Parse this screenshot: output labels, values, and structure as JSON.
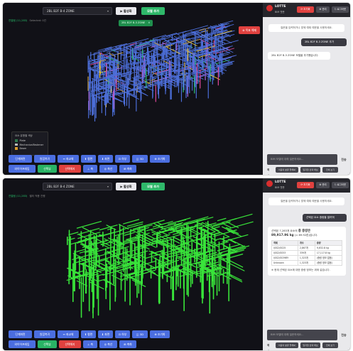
{
  "colors": {
    "green": "#29b365",
    "blue": "#4b6ee0",
    "red": "#e0413f",
    "beam": "#4c6ed8",
    "selected": "#39e43a"
  },
  "panel1": {
    "zone_select": "2BL B2F B-4 ZONE",
    "run_button": "▶ 활성화",
    "add_button": "모델 추가",
    "status": "연결됨 (11,283)",
    "status_sub": "Selected: 0건",
    "zone_chip": "2BL B2F B-3 ZONE",
    "cancel_button": "⊗ 목표 해제",
    "legend": {
      "title": "요소 유형별 색상",
      "items": [
        {
          "label": "Plate",
          "color": "#2e7a4c"
        },
        {
          "label": "MechanicalFastener",
          "color": "#bbbbbb"
        },
        {
          "label": "Beam",
          "color": "#d99a2b"
        }
      ]
    },
    "toolbar_row1": [
      "단계화면",
      "원점복귀",
      "↔ 좌교체",
      "⬆ 평면",
      "⬇ 좌면",
      "⊡ 하부",
      "◫ 3D",
      "⊕ 조기화"
    ],
    "toolbar_row2": [
      "와이어프레임",
      "선택뷰",
      "선택해지",
      "⊥ 축",
      "◎ 축선",
      "⊞ 축화"
    ],
    "chat": {
      "brand": "LOTTE",
      "brand_sub": "BIM 챗봇",
      "reset": "⟳ 초기화",
      "admin": "⚙ 관리",
      "logout": "⎋ 로그아웃",
      "system_msg": "질문을 입력하거나 맞에 예제 예문을 사용하세요.",
      "user_msg": "2BL B2F B-3 ZONE 추가",
      "bot_msg": "2BL B2F B-3 ZONE 모델을 추가했습니다.",
      "input_placeholder": "BIM 모델에 대해 질문하세요...",
      "send": "전송",
      "examples_label": "예시",
      "examples": [
        "이층의 분류 잘해봐",
        "일자형 선택 해보",
        "전체 보기"
      ]
    }
  },
  "panel2": {
    "zone_select": "2BL B2F B-4 ZONE",
    "run_button": "▶ 활성화",
    "add_button": "모델 추가",
    "status": "연결됨 (11,283)",
    "status_sub": "필터 적용 진행",
    "toolbar_row1": [
      "단계화면",
      "원점복귀",
      "↔ 좌교체",
      "⬆ 평면",
      "⬇ 좌면",
      "⊡ 하부",
      "◫ 3D",
      "⊕ 조기화"
    ],
    "toolbar_row2": [
      "와이어프레임",
      "선택뷰",
      "선택해지",
      "⊥ 축",
      "◎ 축선",
      "⊞ 축화"
    ],
    "chat": {
      "brand": "LOTTE",
      "brand_sub": "BIM 챗봇",
      "reset": "⟳ 초기화",
      "admin": "⚙ 관리",
      "logout": "⎋ 로그아웃",
      "system_msg": "질문을 입력하거나 맞에 예제 예문을 사용하세요.",
      "user_msg": "선택된 요소 중량을 알려줘",
      "result_line1": "선택된 7,283개 요소의",
      "result_total_label": "총 중량은",
      "result_total": "89,917.96 kg",
      "result_total_suffix": "(≈ 89.92톤)입니다.",
      "table_headers": [
        "객체",
        "개수",
        "중량"
      ],
      "table_rows": [
        [
          "I/SS2/SS25",
          "2,867개",
          "9,632.8 kg"
        ],
        [
          "I/SS2/SS53",
          "339개",
          "17,117.8 kg"
        ],
        [
          "I/SS2/SS39BY",
          "1,323개",
          "(중량 정보 없음)"
        ],
        [
          "Unknown",
          "1,323개",
          "(중량 정보 없음)"
        ]
      ],
      "note": "※ 현재 선택된 요소에 대한 중량 정보는 위와 같습니다.",
      "input_placeholder": "BIM 모델에 대해 질문하세요...",
      "send": "전송",
      "examples_label": "예시",
      "examples": [
        "이층의 분류 잘해봐",
        "일자형 선택 해보",
        "전체 보기"
      ]
    }
  }
}
